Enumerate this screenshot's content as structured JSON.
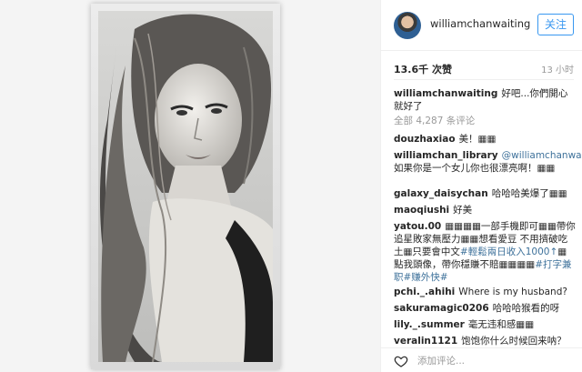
{
  "header": {
    "username": "williamchanwaiting",
    "follow_label": "关注"
  },
  "meta": {
    "likes": "13.6千 次赞",
    "time": "13 小时"
  },
  "caption": {
    "user": "williamchanwaiting",
    "text": "好吧...你們開心就好了"
  },
  "view_all": "全部 4,287 条评论",
  "comments": [
    {
      "user": "douzhaxiao",
      "text": "美！▦▦"
    },
    {
      "user": "williamchan_library",
      "mention": "@williamchanwaiting",
      "text": "如果你是一个女儿你也很漂亮啊！▦▦"
    },
    {
      "user": "galaxy_daisychan",
      "text": "哈哈哈美爆了▦▦"
    },
    {
      "user": "maoqiushi",
      "text": "好美"
    },
    {
      "user": "yatou.00",
      "text": "▦▦▦▦一部手機即可▦▦帶你追星敗家無壓力▦▦想看愛豆 不用擠破吃土▦只要會中文",
      "tag": "#輕鬆兩日收入1000↑",
      "text2": "▦點我頭像，帶你穩賺不賠▦▦▦▦",
      "tag2": "#打字兼职#赚外快#"
    },
    {
      "user": "pchi._.ahihi",
      "text": "Where is my husband?"
    },
    {
      "user": "sakuramagic0206",
      "text": "哈哈哈猴看的呀"
    },
    {
      "user": "lily._.summer",
      "text": "毫无违和感▦▦"
    },
    {
      "user": "veralin1121",
      "text": "饱饱你什么时候回来呐？"
    }
  ],
  "footer": {
    "add_comment_placeholder": "添加评论..."
  },
  "colors": {
    "accent": "#3897f0",
    "link": "#3f729b",
    "muted": "#999999"
  }
}
